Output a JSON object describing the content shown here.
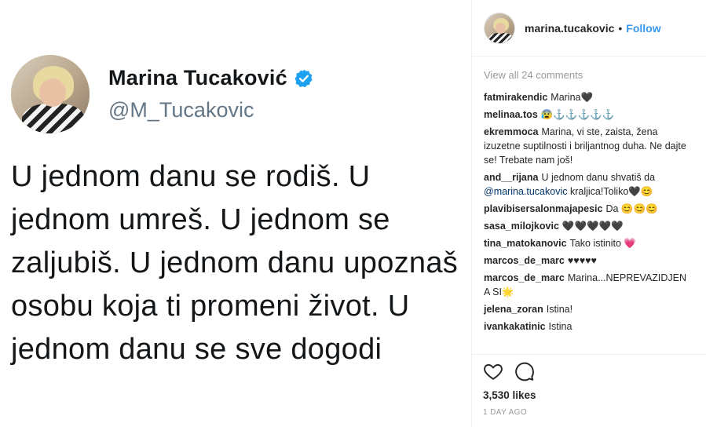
{
  "tweet": {
    "display_name": "Marina Tucaković",
    "handle": "@M_Tucakovic",
    "text": "U jednom danu se rodiš. U jednom umreš. U jednom se zaljubiš. U jednom danu upoznaš osobu koja ti promeni život. U jednom danu se sve dogodi",
    "verified_color": "#1da1f2"
  },
  "post": {
    "username": "marina.tucakovic",
    "separator": "•",
    "follow_label": "Follow",
    "view_all_label": "View all 24 comments",
    "likes_label": "3,530 likes",
    "time_label": "1 DAY AGO",
    "accent_color": "#3897f0"
  },
  "comments": [
    {
      "user": "fatmirakendic",
      "text": "Marina🖤"
    },
    {
      "user": "melinaa.tos",
      "text": "😰⚓⚓⚓⚓⚓"
    },
    {
      "user": "ekremmoca",
      "text": "Marina, vi ste, zaista, žena izuzetne suptilnosti i briljantnog duha. Ne dajte se! Trebate nam još!"
    },
    {
      "user": "and__rijana",
      "text": "U jednom danu shvatiš da ",
      "mention": "@marina.tucakovic",
      "text_after": " kraljica!Toliko🖤😊"
    },
    {
      "user": "plavibisersalonmajapesic",
      "text": "Da 😊😊😊"
    },
    {
      "user": "sasa_milojkovic",
      "text": "🖤🖤🖤🖤🖤"
    },
    {
      "user": "tina_matokanovic",
      "text": "Tako istinito 💗"
    },
    {
      "user": "marcos_de_marc",
      "text": "♥♥♥♥♥"
    },
    {
      "user": "marcos_de_marc",
      "text": "Marina...NEPREVAZIDJEN A SI🌟"
    },
    {
      "user": "jelena_zoran",
      "text": "Istina!"
    },
    {
      "user": "ivankakatinic",
      "text": "Istina"
    }
  ],
  "icons": {
    "like": "heart-icon",
    "comment": "comment-icon",
    "verified": "verified-badge-icon"
  }
}
